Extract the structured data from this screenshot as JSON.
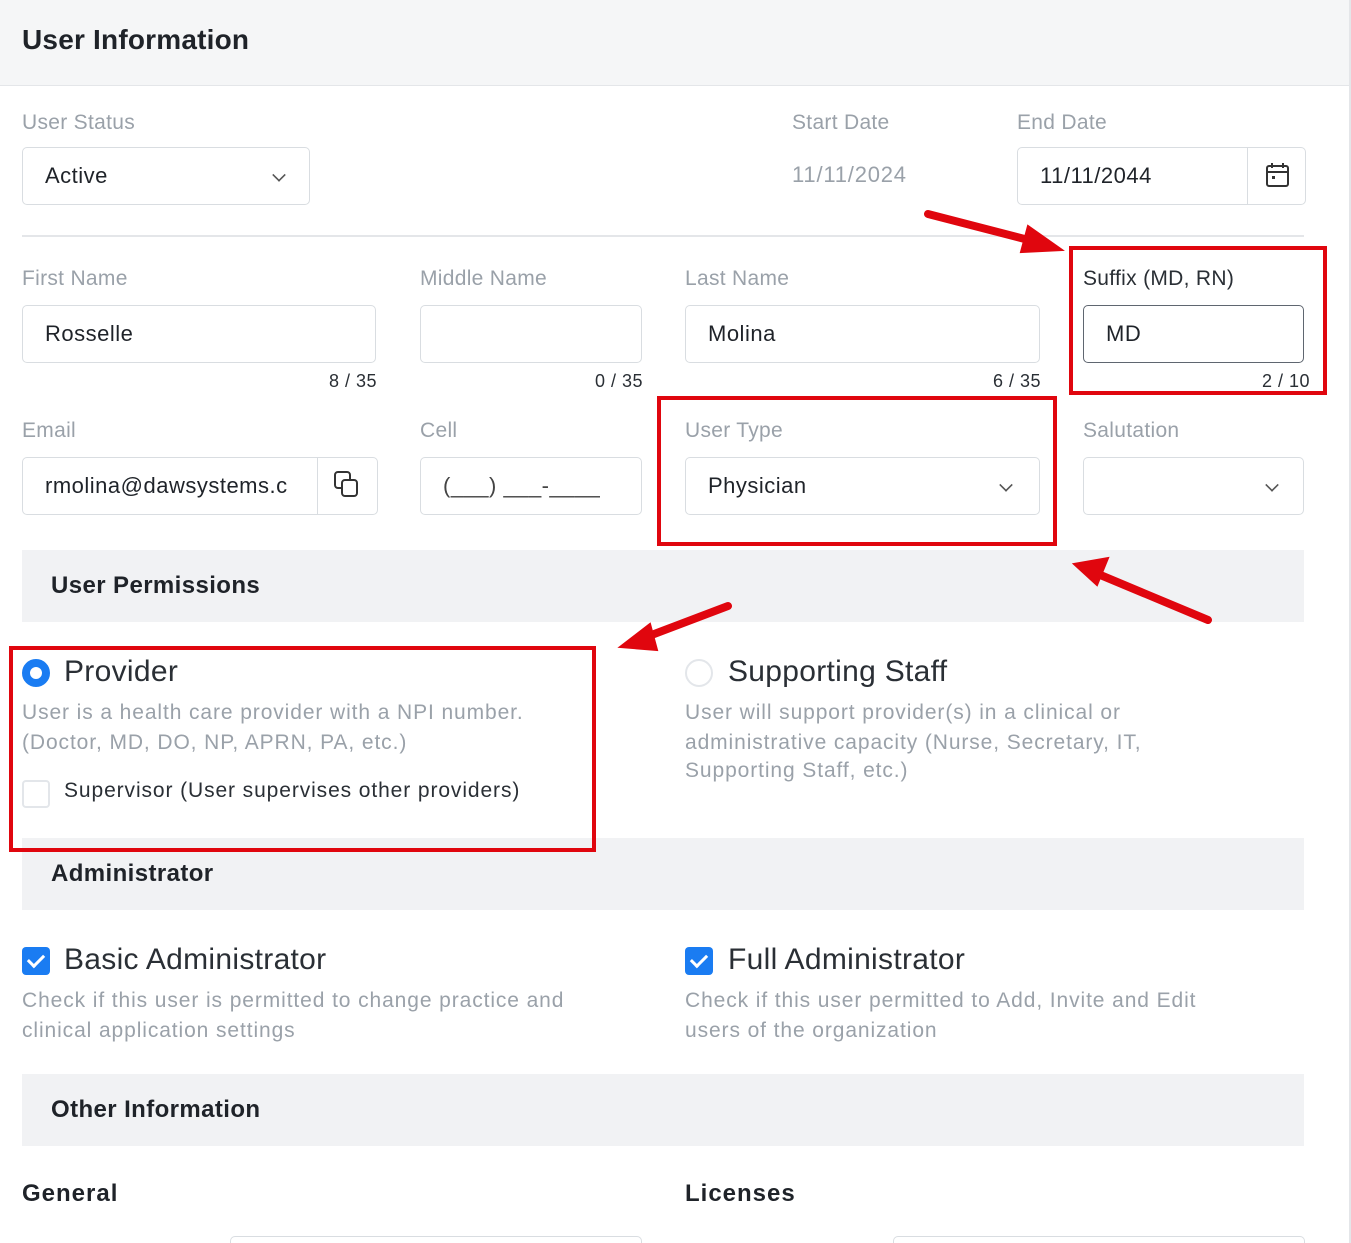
{
  "header": {
    "title": "User Information"
  },
  "status": {
    "label": "User Status",
    "value": "Active"
  },
  "start_date": {
    "label": "Start Date",
    "value": "11/11/2024"
  },
  "end_date": {
    "label": "End Date",
    "value": "11/11/2044"
  },
  "first_name": {
    "label": "First Name",
    "value": "Rosselle",
    "counter": "8 / 35"
  },
  "middle_name": {
    "label": "Middle Name",
    "value": "",
    "counter": "0 / 35"
  },
  "last_name": {
    "label": "Last Name",
    "value": "Molina",
    "counter": "6 / 35"
  },
  "suffix": {
    "label": "Suffix (MD, RN)",
    "value": "MD",
    "counter": "2 / 10"
  },
  "email": {
    "label": "Email",
    "value": "rmolina@dawsystems.c"
  },
  "cell": {
    "label": "Cell",
    "placeholder": "(___) ___-____"
  },
  "user_type": {
    "label": "User Type",
    "value": "Physician"
  },
  "salutation": {
    "label": "Salutation",
    "value": ""
  },
  "permissions": {
    "title": "User Permissions",
    "provider": {
      "label": "Provider",
      "desc1": "User is a health care provider with a NPI number.",
      "desc2": "(Doctor, MD, DO, NP, APRN, PA, etc.)",
      "selected": true,
      "supervisor_label": "Supervisor (User supervises other providers)",
      "supervisor_checked": false
    },
    "staff": {
      "label": "Supporting Staff",
      "desc1": "User will support provider(s) in a clinical or",
      "desc2": "administrative capacity (Nurse, Secretary, IT,",
      "desc3": "Supporting Staff, etc.)",
      "selected": false
    }
  },
  "administrator": {
    "title": "Administrator",
    "basic": {
      "label": "Basic Administrator",
      "desc1": "Check if this user is permitted to change practice and",
      "desc2": "clinical application settings",
      "checked": true
    },
    "full": {
      "label": "Full Administrator",
      "desc1": "Check if this user permitted to Add, Invite and Edit",
      "desc2": "users of the organization",
      "checked": true
    }
  },
  "other": {
    "title": "Other Information",
    "general": "General",
    "licenses": "Licenses"
  },
  "colors": {
    "accent": "#1a7cf2",
    "annotation": "#e0060e",
    "muted": "#9aa1a9"
  },
  "icons": {
    "dropdown": "chevron-down-icon",
    "calendar": "calendar-icon",
    "copy": "copy-icon"
  }
}
